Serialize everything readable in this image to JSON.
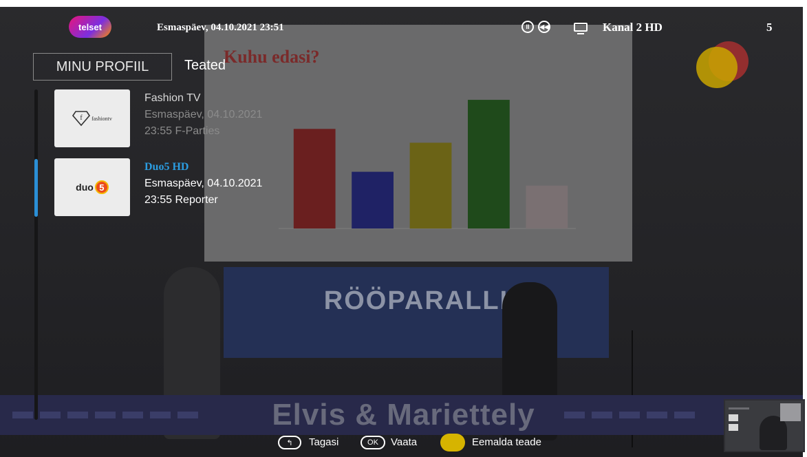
{
  "header": {
    "logo_text": "telset",
    "datetime": "Esmaspäev, 04.10.2021   23:51",
    "channel_name": "Kanal 2 HD",
    "channel_number": "5",
    "playback_icons": [
      "pause-icon",
      "rewind-icon"
    ],
    "tv_icon": "tv-icon"
  },
  "tabs": {
    "profile": "MINU PROFIIL",
    "notifications": "Teated"
  },
  "notifications": [
    {
      "channel": "Fashion TV",
      "date": "Esmaspäev, 04.10.2021",
      "program": "23:55 F-Parties",
      "logo": "f-fashiontv-logo",
      "logo_text": "fashiontv",
      "selected": false
    },
    {
      "channel": "Duo5 HD",
      "date": "Esmaspäev, 04.10.2021",
      "program": "23:55 Reporter",
      "logo": "duo5-logo",
      "logo_text": "duo",
      "logo_number": "5",
      "selected": true
    }
  ],
  "footer": {
    "back_label": "Tagasi",
    "ok_glyph": "OK",
    "ok_label": "Vaata",
    "yellow_label": "Eemalda teade"
  },
  "background": {
    "slide_title": "Kuhu edasi?",
    "banner_text": "RÖÖPARALLI",
    "lower_title": "Elvis & Mariettely"
  },
  "colors": {
    "accent": "#2b9ce0",
    "yellow_button": "#d6b400"
  },
  "chart_data": {
    "type": "bar",
    "title": "Kuhu edasi?",
    "categories": [
      "",
      "",
      "",
      "",
      ""
    ],
    "values": [
      72,
      41,
      62,
      93,
      31
    ],
    "colors": [
      "#6a1f1f",
      "#1f2265",
      "#6b6316",
      "#1f4a1b",
      "#7a7072"
    ],
    "ylim": [
      0,
      100
    ]
  }
}
